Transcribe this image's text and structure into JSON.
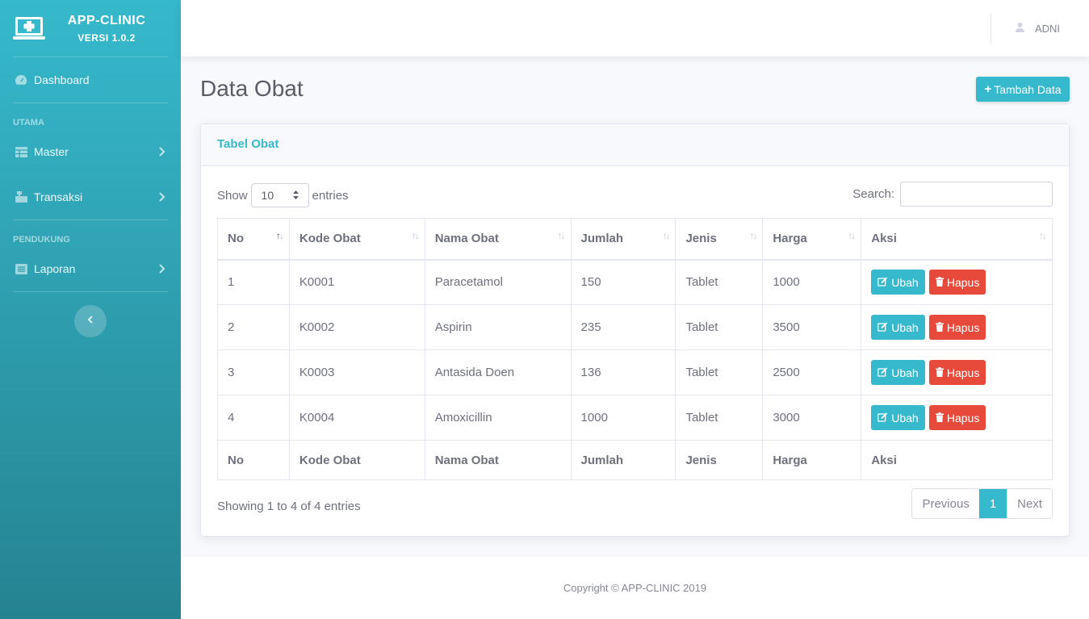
{
  "brand": {
    "name": "APP-CLINIC",
    "version": "VERSI 1.0.2"
  },
  "sidebar": {
    "dashboard": "Dashboard",
    "heading_utama": "UTAMA",
    "master": "Master",
    "transaksi": "Transaksi",
    "heading_pendukung": "PENDUKUNG",
    "laporan": "Laporan"
  },
  "topbar": {
    "user": "ADNI"
  },
  "page": {
    "title": "Data Obat",
    "add_button": "Tambah Data"
  },
  "card": {
    "title": "Tabel Obat",
    "show_label": "Show",
    "entries_label": "entries",
    "page_size": "10",
    "search_label": "Search:",
    "search_value": ""
  },
  "table": {
    "headers": [
      "No",
      "Kode Obat",
      "Nama Obat",
      "Jumlah",
      "Jenis",
      "Harga",
      "Aksi"
    ],
    "rows": [
      [
        "1",
        "K0001",
        "Paracetamol",
        "150",
        "Tablet",
        "1000"
      ],
      [
        "2",
        "K0002",
        "Aspirin",
        "235",
        "Tablet",
        "3500"
      ],
      [
        "3",
        "K0003",
        "Antasida Doen",
        "136",
        "Tablet",
        "2500"
      ],
      [
        "4",
        "K0004",
        "Amoxicillin",
        "1000",
        "Tablet",
        "3000"
      ]
    ],
    "edit_label": "Ubah",
    "delete_label": "Hapus"
  },
  "info": "Showing 1 to 4 of 4 entries",
  "pagination": {
    "previous": "Previous",
    "current": "1",
    "next": "Next"
  },
  "footer": "Copyright © APP-CLINIC 2019",
  "colors": {
    "accent": "#36b9cc",
    "danger": "#e74a3b",
    "text": "#5a5c69"
  }
}
